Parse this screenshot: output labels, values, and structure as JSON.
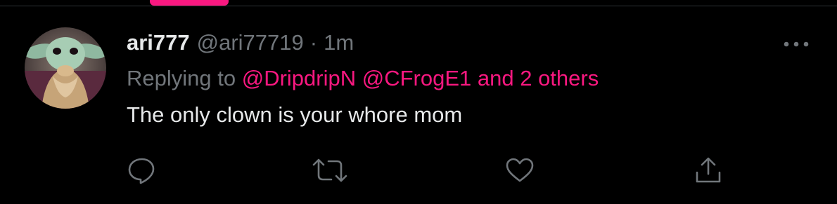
{
  "colors": {
    "background": "#000000",
    "accent": "#f91880",
    "text_primary": "#e7e9ea",
    "text_secondary": "#71767b",
    "border": "#2f3336"
  },
  "tweet": {
    "display_name": "ari777",
    "handle": "@ari77719",
    "separator": "·",
    "time": "1m",
    "replying_prefix": "Replying to",
    "mentions": [
      "@DripdripN",
      "@CFrogE1",
      "and 2 others"
    ],
    "text": "The only clown is your whore mom",
    "avatar_icon": "avatar-image"
  },
  "actions": [
    {
      "name": "reply",
      "icon": "speech-bubble-icon"
    },
    {
      "name": "retweet",
      "icon": "retweet-icon"
    },
    {
      "name": "like",
      "icon": "heart-icon"
    },
    {
      "name": "share",
      "icon": "share-icon"
    }
  ],
  "more_icon": "more-dots-icon"
}
